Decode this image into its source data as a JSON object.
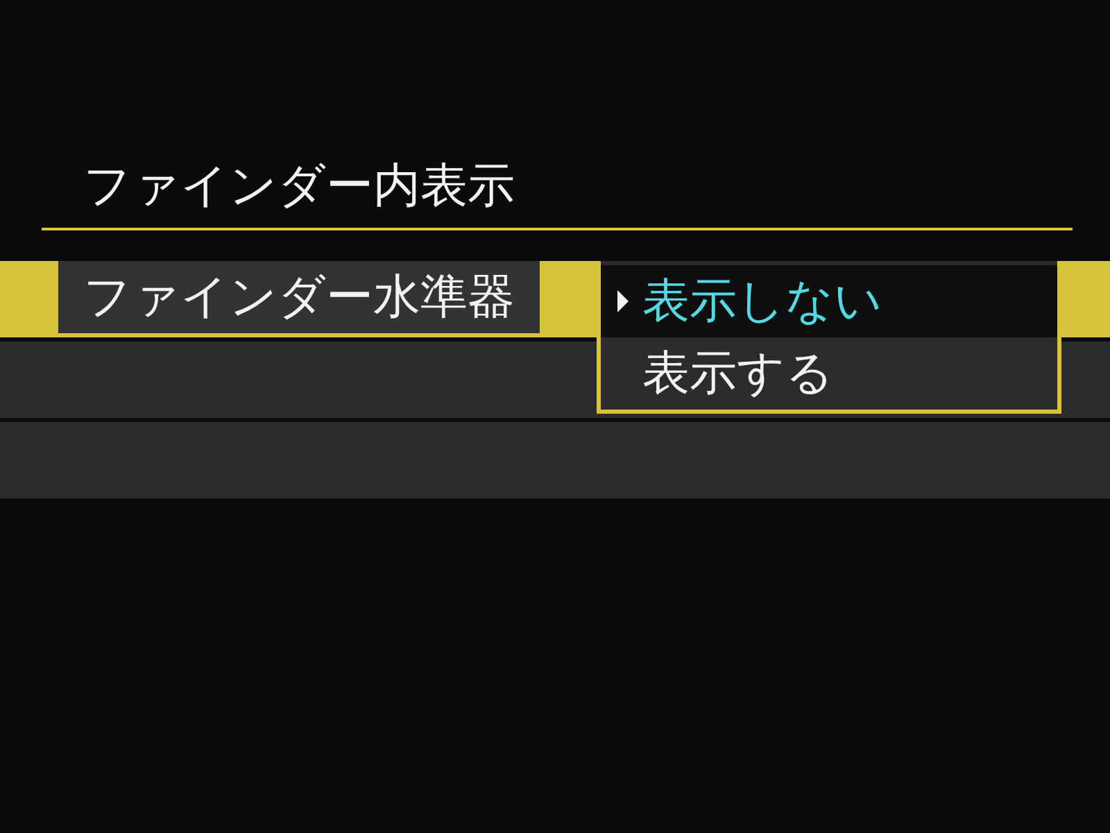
{
  "header": {
    "title": "ファインダー内表示"
  },
  "menu_items": [
    {
      "label": "ファインダー水準器",
      "selected": true
    }
  ],
  "dropdown": {
    "options": [
      {
        "label": "表示しない",
        "selected": true
      },
      {
        "label": "表示する",
        "selected": false
      }
    ]
  }
}
